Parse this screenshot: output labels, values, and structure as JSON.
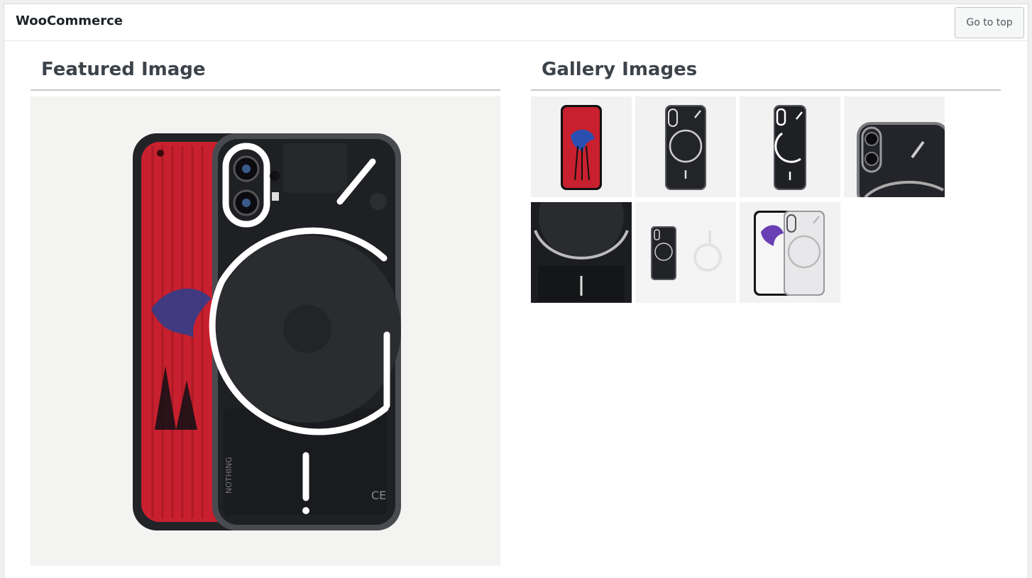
{
  "app": {
    "title": "WooCommerce"
  },
  "toolbar": {
    "go_top_label": "Go to top"
  },
  "featured": {
    "heading": "Featured Image",
    "image": {
      "subject": "phone-back-and-front-photo"
    }
  },
  "gallery": {
    "heading": "Gallery Images",
    "items": [
      {
        "subject": "phone-front-red-screen"
      },
      {
        "subject": "phone-back-dark"
      },
      {
        "subject": "phone-back-dark-angled"
      },
      {
        "subject": "phone-camera-closeup"
      },
      {
        "subject": "phone-back-closeup-dark"
      },
      {
        "subject": "phone-with-cable"
      },
      {
        "subject": "phone-front-and-back-white"
      }
    ]
  },
  "colors": {
    "accent_red": "#c8202e",
    "phone_black": "#2a2b2e",
    "glow": "#ffffff",
    "panel_bg": "#f3f3f2"
  }
}
